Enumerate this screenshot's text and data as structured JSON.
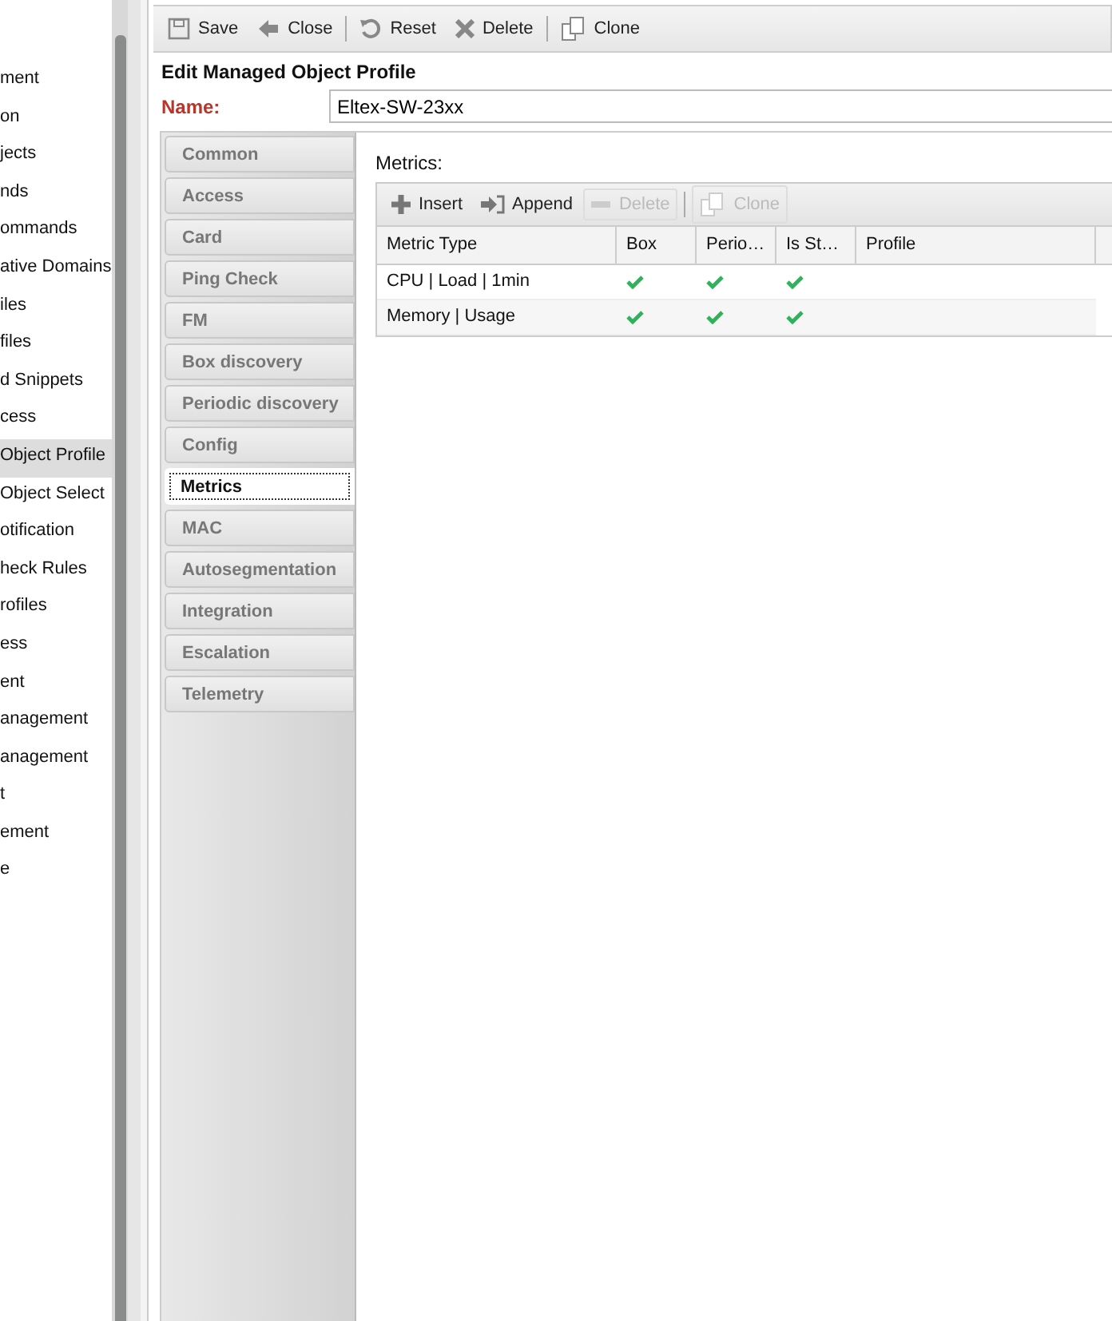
{
  "sidebar": {
    "items": [
      {
        "label": "ment",
        "selected": false
      },
      {
        "label": "on",
        "selected": false
      },
      {
        "label": "jects",
        "selected": false
      },
      {
        "label": "nds",
        "selected": false
      },
      {
        "label": "ommands",
        "selected": false
      },
      {
        "label": "ative Domains",
        "selected": false
      },
      {
        "label": "iles",
        "selected": false
      },
      {
        "label": "files",
        "selected": false
      },
      {
        "label": "d Snippets",
        "selected": false
      },
      {
        "label": "cess",
        "selected": false
      },
      {
        "label": "Object Profile",
        "selected": true
      },
      {
        "label": "Object Select",
        "selected": false
      },
      {
        "label": "otification",
        "selected": false
      },
      {
        "label": "heck Rules",
        "selected": false
      },
      {
        "label": "rofiles",
        "selected": false
      },
      {
        "label": "ess",
        "selected": false
      },
      {
        "label": "ent",
        "selected": false
      },
      {
        "label": "anagement",
        "selected": false
      },
      {
        "label": "anagement",
        "selected": false
      },
      {
        "label": "t",
        "selected": false
      },
      {
        "label": "ement",
        "selected": false
      },
      {
        "label": "e",
        "selected": false
      }
    ]
  },
  "toolbar": [
    {
      "label": "Save",
      "kind": "save"
    },
    {
      "label": "Close",
      "kind": "back"
    },
    {
      "label": "Reset",
      "kind": "reset"
    },
    {
      "label": "Delete",
      "kind": "delete"
    },
    {
      "label": "Clone",
      "kind": "clone"
    }
  ],
  "form": {
    "title": "Edit Managed Object Profile",
    "name_label": "Name:",
    "name_value": "Eltex-SW-23xx"
  },
  "tabs": [
    {
      "label": "Common",
      "selected": false
    },
    {
      "label": "Access",
      "selected": false
    },
    {
      "label": "Card",
      "selected": false
    },
    {
      "label": "Ping Check",
      "selected": false
    },
    {
      "label": "FM",
      "selected": false
    },
    {
      "label": "Box discovery",
      "selected": false
    },
    {
      "label": "Periodic discovery",
      "selected": false
    },
    {
      "label": "Config",
      "selected": false
    },
    {
      "label": "Metrics",
      "selected": true
    },
    {
      "label": "MAC",
      "selected": false
    },
    {
      "label": "Autosegmentation",
      "selected": false
    },
    {
      "label": "Integration",
      "selected": false
    },
    {
      "label": "Escalation",
      "selected": false
    },
    {
      "label": "Telemetry",
      "selected": false
    }
  ],
  "metrics": {
    "label": "Metrics:",
    "toolbar": [
      {
        "label": "Insert",
        "kind": "plus",
        "disabled": false
      },
      {
        "label": "Append",
        "kind": "append",
        "disabled": false
      },
      {
        "label": "Delete",
        "kind": "minus",
        "disabled": true
      },
      {
        "label": "Clone",
        "kind": "clone",
        "disabled": true
      }
    ],
    "columns": [
      "Metric Type",
      "Box",
      "Perio…",
      "Is St…",
      "Profile"
    ],
    "rows": [
      {
        "metric_type": "CPU | Load | 1min",
        "box": true,
        "periodic": true,
        "is_stored": true
      },
      {
        "metric_type": "Memory | Usage",
        "box": true,
        "periodic": true,
        "is_stored": true
      }
    ]
  }
}
